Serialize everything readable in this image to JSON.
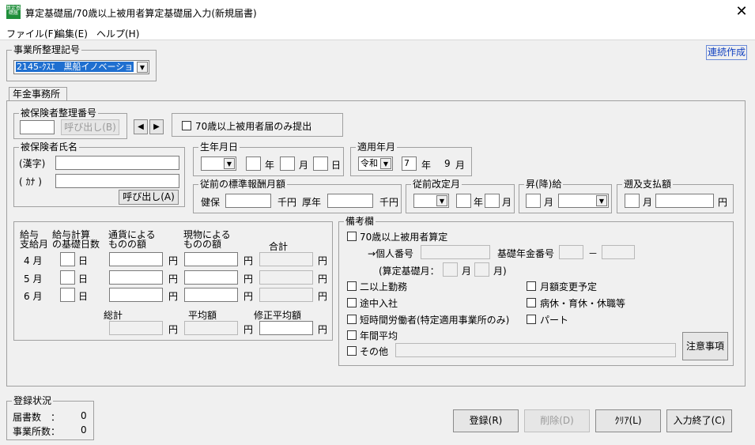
{
  "window": {
    "title": "算定基礎届/70歳以上被用者算定基礎届入力(新規届書)",
    "icon_text": "算定基礎届"
  },
  "menu": [
    {
      "label": "ファイル(F)"
    },
    {
      "label": "編集(E)"
    },
    {
      "label": "ヘルプ(H)"
    }
  ],
  "office": {
    "group_label": "事業所整理記号",
    "value": "2145-ｸｽｴ　黒船イノベーショ",
    "continuous_label": "連続作成"
  },
  "tab": {
    "label": "年金事務所"
  },
  "insured_no": {
    "group_label": "被保険者整理番号",
    "call_label": "呼び出し(B)",
    "prev": "◀",
    "next": "▶"
  },
  "over70_only": {
    "label": "70歳以上被用者届のみ提出"
  },
  "name": {
    "group_label": "被保険者氏名",
    "kanji_label": "(漢字)",
    "kana_label": "( ｶﾅ )",
    "call_label": "呼び出し(A)"
  },
  "birth": {
    "group_label": "生年月日",
    "year": "年",
    "month": "月",
    "day": "日"
  },
  "apply": {
    "group_label": "適用年月",
    "era": "令和",
    "year_value": "7",
    "year_unit": "年",
    "month_value": "9",
    "month_unit": "月"
  },
  "prev_salary": {
    "group_label": "従前の標準報酬月額",
    "health_label": "健保",
    "unit1": "千円",
    "pension_label": "厚年",
    "unit2": "千円"
  },
  "prev_revision": {
    "group_label": "従前改定月",
    "year": "年",
    "month": "月"
  },
  "raise": {
    "group_label": "昇(降)給",
    "month": "月"
  },
  "retro": {
    "group_label": "遡及支払額",
    "month": "月",
    "yen": "円"
  },
  "salary_table": {
    "header_pay_month": "給与\n支給月",
    "header_days": "給与計算\nの基礎日数",
    "header_currency": "通貨による\nものの額",
    "header_kind": "現物による\nものの額",
    "header_total": "合計",
    "rows": [
      {
        "month": "4 月"
      },
      {
        "month": "5 月"
      },
      {
        "month": "6 月"
      }
    ],
    "day_unit": "日",
    "yen": "円",
    "sum_label": "総計",
    "avg_label": "平均額",
    "adj_avg_label": "修正平均額"
  },
  "remarks": {
    "group_label": "備考欄",
    "over70_calc": "70歳以上被用者算定",
    "personal_no": "→個人番号",
    "basic_pension_no": "基礎年金番号",
    "dash": "－",
    "calc_base_month": "(算定基礎月：",
    "month_a": "月",
    "month_b": "月)",
    "multi_job": "二以上勤務",
    "monthly_change": "月額変更予定",
    "mid_join": "途中入社",
    "leave": "病休・育休・休職等",
    "short_time": "短時間労働者(特定適用事業所のみ)",
    "part": "パート",
    "annual_avg": "年間平均",
    "other": "その他",
    "notes_button": "注意事項"
  },
  "status": {
    "group_label": "登録状況",
    "docs_label": "届書数　：",
    "docs_value": "0",
    "offices_label": "事業所数：",
    "offices_value": "0"
  },
  "buttons": {
    "register": "登録(R)",
    "delete": "削除(D)",
    "clear": "ｸﾘｱ(L)",
    "finish": "入力終了(C)"
  }
}
